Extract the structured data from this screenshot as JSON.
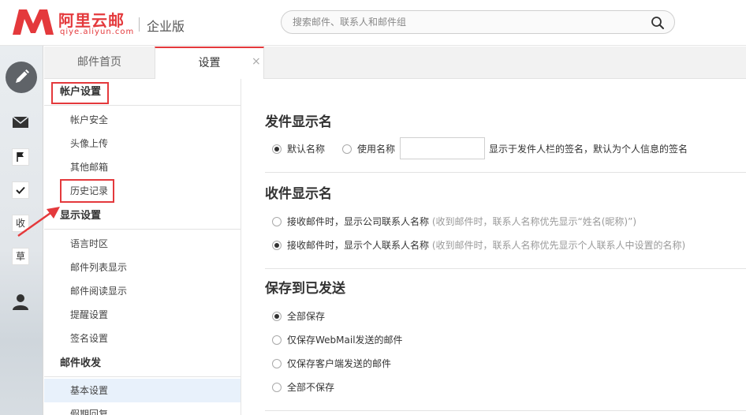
{
  "header": {
    "brand_name": "阿里云邮",
    "brand_url": "qiye.aliyun.com",
    "edition": "企业版",
    "search_placeholder": "搜索邮件、联系人和邮件组"
  },
  "rail": {
    "icons": [
      "compose-icon",
      "mail-icon",
      "flag-icon",
      "check-icon",
      "inbox-shortcut",
      "draft-shortcut",
      "contacts-icon"
    ],
    "inbox_char": "收",
    "draft_char": "草"
  },
  "tabs": {
    "home_label": "邮件首页",
    "settings_label": "设置",
    "close_glyph": "×"
  },
  "menu": {
    "account_group": "帐户设置",
    "account_items": [
      "帐户安全",
      "头像上传",
      "其他邮箱",
      "历史记录"
    ],
    "display_group": "显示设置",
    "display_items": [
      "语言时区",
      "邮件列表显示",
      "邮件阅读显示",
      "提醒设置",
      "签名设置"
    ],
    "mail_group": "邮件收发",
    "mail_items": [
      "基本设置",
      "假期回复"
    ]
  },
  "sender_name": {
    "title": "发件显示名",
    "option_default": "默认名称",
    "option_custom": "使用名称",
    "custom_value": "",
    "hint": "显示于发件人栏的签名，默认为个人信息的签名"
  },
  "receiver_name": {
    "title": "收件显示名",
    "option_company": "接收邮件时，显示公司联系人名称",
    "option_company_note": "(收到邮件时，联系人名称优先显示“姓名(昵称)”)",
    "option_personal": "接收邮件时，显示个人联系人名称",
    "option_personal_note": "(收到邮件时，联系人名称优先显示个人联系人中设置的名称)"
  },
  "save_sent": {
    "title": "保存到已发送",
    "options": [
      "全部保存",
      "仅保存WebMail发送的邮件",
      "仅保存客户端发送的邮件",
      "全部不保存"
    ]
  },
  "colors": {
    "brand_red": "#e4393c",
    "annotation_red": "#e4393c"
  }
}
